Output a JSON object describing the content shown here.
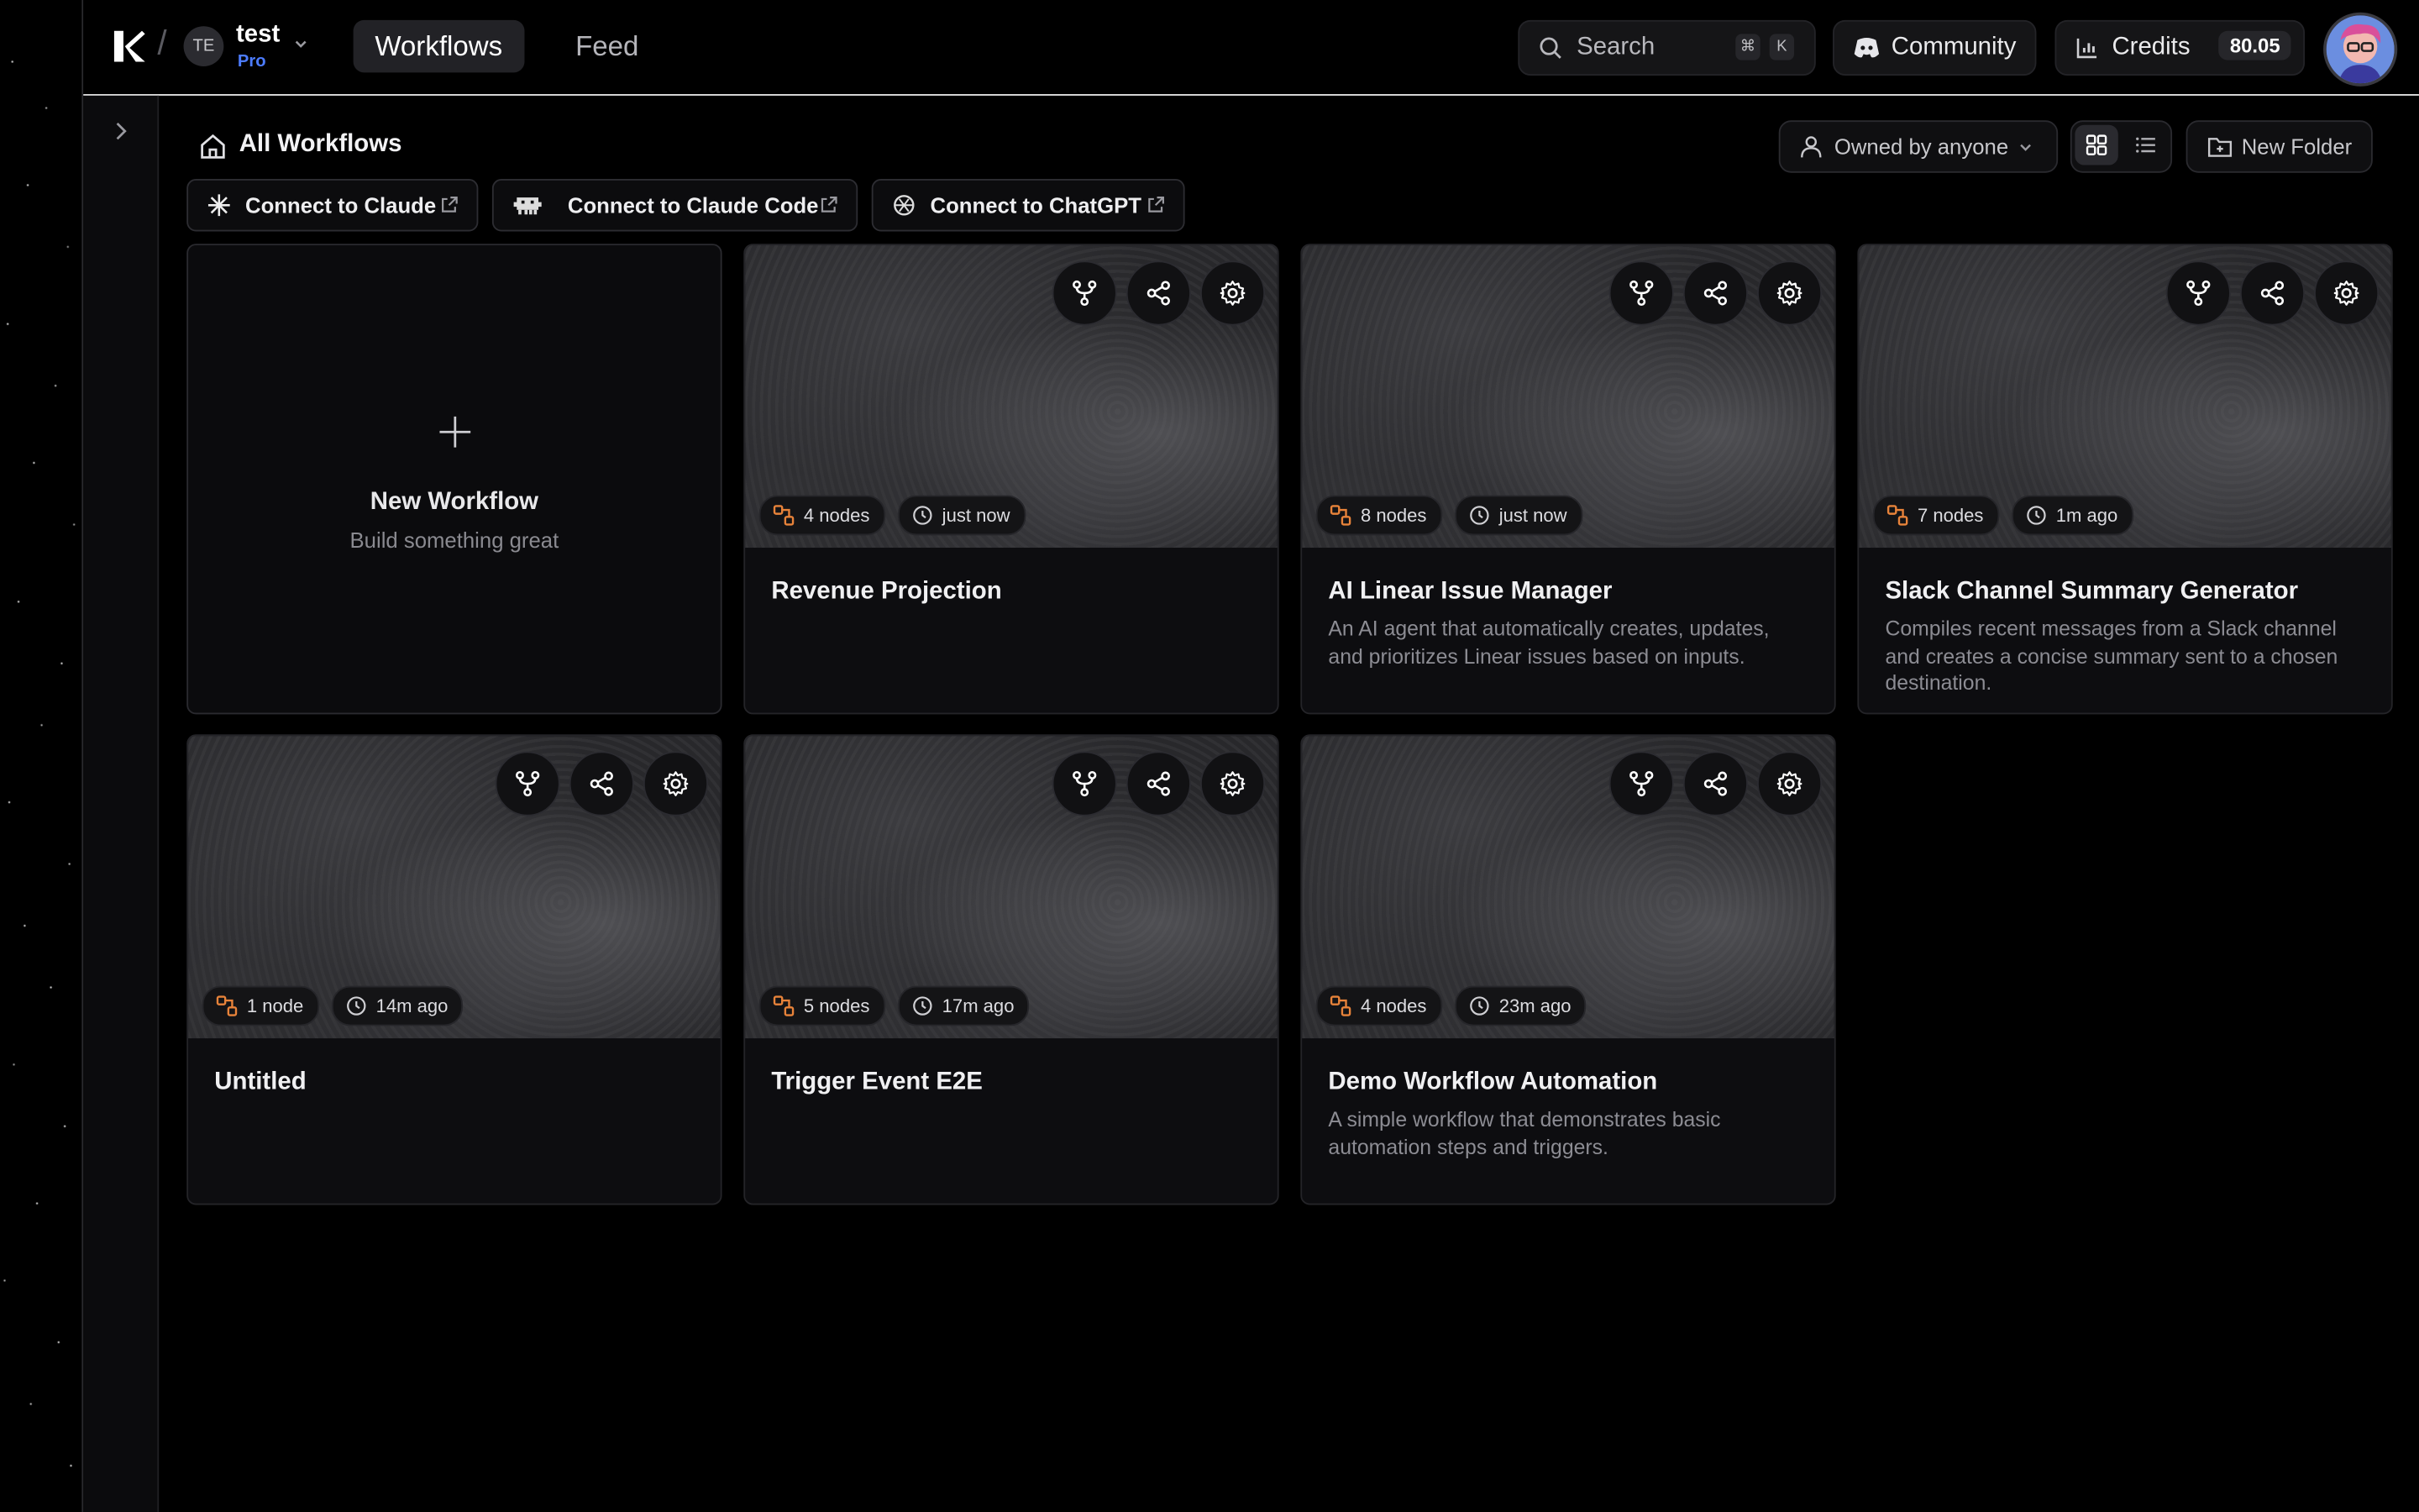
{
  "topbar": {
    "team_initials": "TE",
    "team_name": "test",
    "team_plan": "Pro",
    "tabs": [
      {
        "label": "Workflows",
        "active": true
      },
      {
        "label": "Feed",
        "active": false
      }
    ],
    "search_label": "Search",
    "search_shortcut": [
      "⌘",
      "K"
    ],
    "community_label": "Community",
    "credits_label": "Credits",
    "credits_value": "80.05"
  },
  "page": {
    "title": "All Workflows",
    "owner_filter": "Owned by anyone",
    "new_folder": "New Folder"
  },
  "connect": [
    {
      "label": "Connect to Claude"
    },
    {
      "label": "Connect to Claude Code"
    },
    {
      "label": "Connect to ChatGPT"
    }
  ],
  "new_workflow": {
    "title": "New Workflow",
    "subtitle": "Build something great"
  },
  "workflows": [
    {
      "title": "Revenue Projection",
      "nodes": "4 nodes",
      "time": "just now",
      "description": ""
    },
    {
      "title": "AI Linear Issue Manager",
      "nodes": "8 nodes",
      "time": "just now",
      "description": "An AI agent that automatically creates, updates, and prioritizes Linear issues based on inputs."
    },
    {
      "title": "Slack Channel Summary Generator",
      "nodes": "7 nodes",
      "time": "1m ago",
      "description": "Compiles recent messages from a Slack channel and creates a concise summary sent to a chosen destination."
    },
    {
      "title": "Untitled",
      "nodes": "1 node",
      "time": "14m ago",
      "description": ""
    },
    {
      "title": "Trigger Event E2E",
      "nodes": "5 nodes",
      "time": "17m ago",
      "description": ""
    },
    {
      "title": "Demo Workflow Automation",
      "nodes": "4 nodes",
      "time": "23m ago",
      "description": "A simple workflow that demonstrates basic automation steps and triggers."
    }
  ],
  "colors": {
    "accent": "#4c7cff",
    "node_icon": "#e8833a",
    "border": "#242428"
  }
}
